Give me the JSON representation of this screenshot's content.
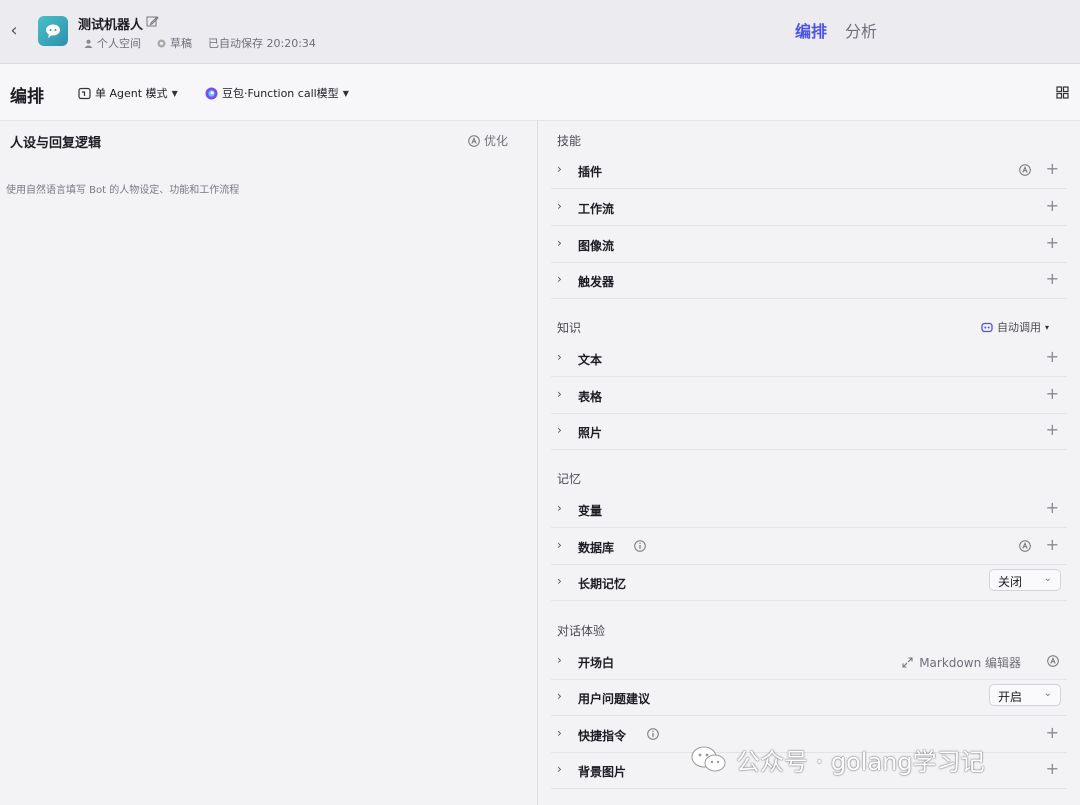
{
  "header": {
    "back_icon": "chevron-left-icon",
    "bot_name": "测试机器人",
    "workspace": "个人空间",
    "status": "草稿",
    "autosave": "已自动保存 20:20:34",
    "tabs": [
      {
        "label": "编排",
        "active": true
      },
      {
        "label": "分析",
        "active": false
      }
    ],
    "accent_color": "#4d53e8"
  },
  "toolbar": {
    "title": "编排",
    "mode_label": "单 Agent 模式",
    "model_label": "豆包·Function call模型"
  },
  "prompt_panel": {
    "title": "人设与回复逻辑",
    "optimize_label": "优化",
    "placeholder": "使用自然语言填写 Bot 的人物设定、功能和工作流程"
  },
  "sections": {
    "skills": {
      "title": "技能",
      "items": [
        {
          "label": "插件"
        },
        {
          "label": "工作流"
        },
        {
          "label": "图像流"
        },
        {
          "label": "触发器"
        }
      ]
    },
    "knowledge": {
      "title": "知识",
      "auto_call_label": "自动调用",
      "items": [
        {
          "label": "文本"
        },
        {
          "label": "表格"
        },
        {
          "label": "照片"
        }
      ]
    },
    "memory": {
      "title": "记忆",
      "items": [
        {
          "label": "变量"
        },
        {
          "label": "数据库"
        },
        {
          "label": "长期记忆",
          "dropdown_value": "关闭"
        }
      ]
    },
    "experience": {
      "title": "对话体验",
      "items": [
        {
          "label": "开场白",
          "extra": "Markdown 编辑器"
        },
        {
          "label": "用户问题建议",
          "dropdown_value": "开启"
        },
        {
          "label": "快捷指令"
        },
        {
          "label": "背景图片"
        }
      ]
    }
  },
  "watermark": {
    "text": "公众号 · golang学习记"
  }
}
